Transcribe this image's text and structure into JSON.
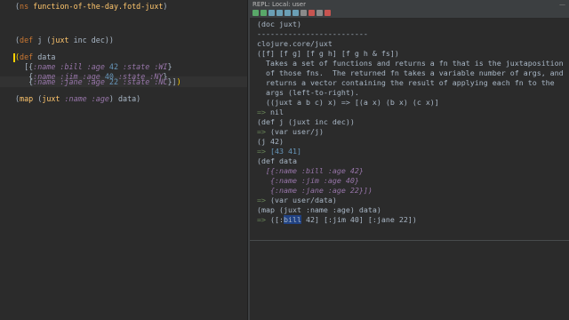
{
  "repl": {
    "title": "REPL: Local: user",
    "minimize": "—",
    "toolbar_icons": [
      "run-icon",
      "rerun-icon",
      "stop-icon",
      "step-icon",
      "history-icon",
      "clear-icon",
      "load-icon",
      "settings-icon",
      "pin-icon",
      "close-icon"
    ]
  },
  "editor": {
    "l1_ns": "ns",
    "l1_name": "function-of-the-day.fotd-juxt",
    "l2_def": "def",
    "l2_name": "j",
    "l2_juxt": "juxt",
    "l2_args": "inc dec))",
    "l3_def": "def",
    "l3_name": "data",
    "row1_name": ":name :bill",
    "row1_age_k": ":age",
    "row1_age": "42",
    "row1_state": ":state :WI",
    "row2_name": ":name :jim",
    "row2_age_k": ":age",
    "row2_age": "40",
    "row2_state": ":state :NY",
    "row3_name": ":name :jane",
    "row3_age_k": ":age",
    "row3_age": "22",
    "row3_state": ":state :NC",
    "l4_map": "map",
    "l4_juxt": "juxt",
    "l4_keys": ":name :age",
    "l4_data": "data)"
  },
  "output": {
    "doc_call": "(doc juxt)",
    "sep": "-------------------------",
    "fq": "clojure.core/juxt",
    "sig": "([f] [f g] [f g h] [f g h & fs])",
    "doc1": "  Takes a set of functions and returns a fn that is the juxtaposition",
    "doc2": "  of those fns.  The returned fn takes a variable number of args, and",
    "doc3": "  returns a vector containing the result of applying each fn to the",
    "doc4": "  args (left-to-right).",
    "doc5": "  ((juxt a b c) x) => [(a x) (b x) (c x)]",
    "nil": "nil",
    "def_j": "(def j (juxt inc dec))",
    "var_j": "(var user/j)",
    "call_j": "(j 42)",
    "res_j": "[43 41]",
    "def_data": "(def data",
    "d1": "  [{:name :bill :age 42}",
    "d2": "   {:name :jim :age 40}",
    "d3": "   {:name :jane :age 22}])",
    "var_data": "(var user/data)",
    "map_call": "(map (juxt :name :age) data)",
    "res_map_a": "([:",
    "res_map_sel": "bill",
    "res_map_b": " 42] [:jim 40] [:jane 22])",
    "arrow": "=>"
  }
}
